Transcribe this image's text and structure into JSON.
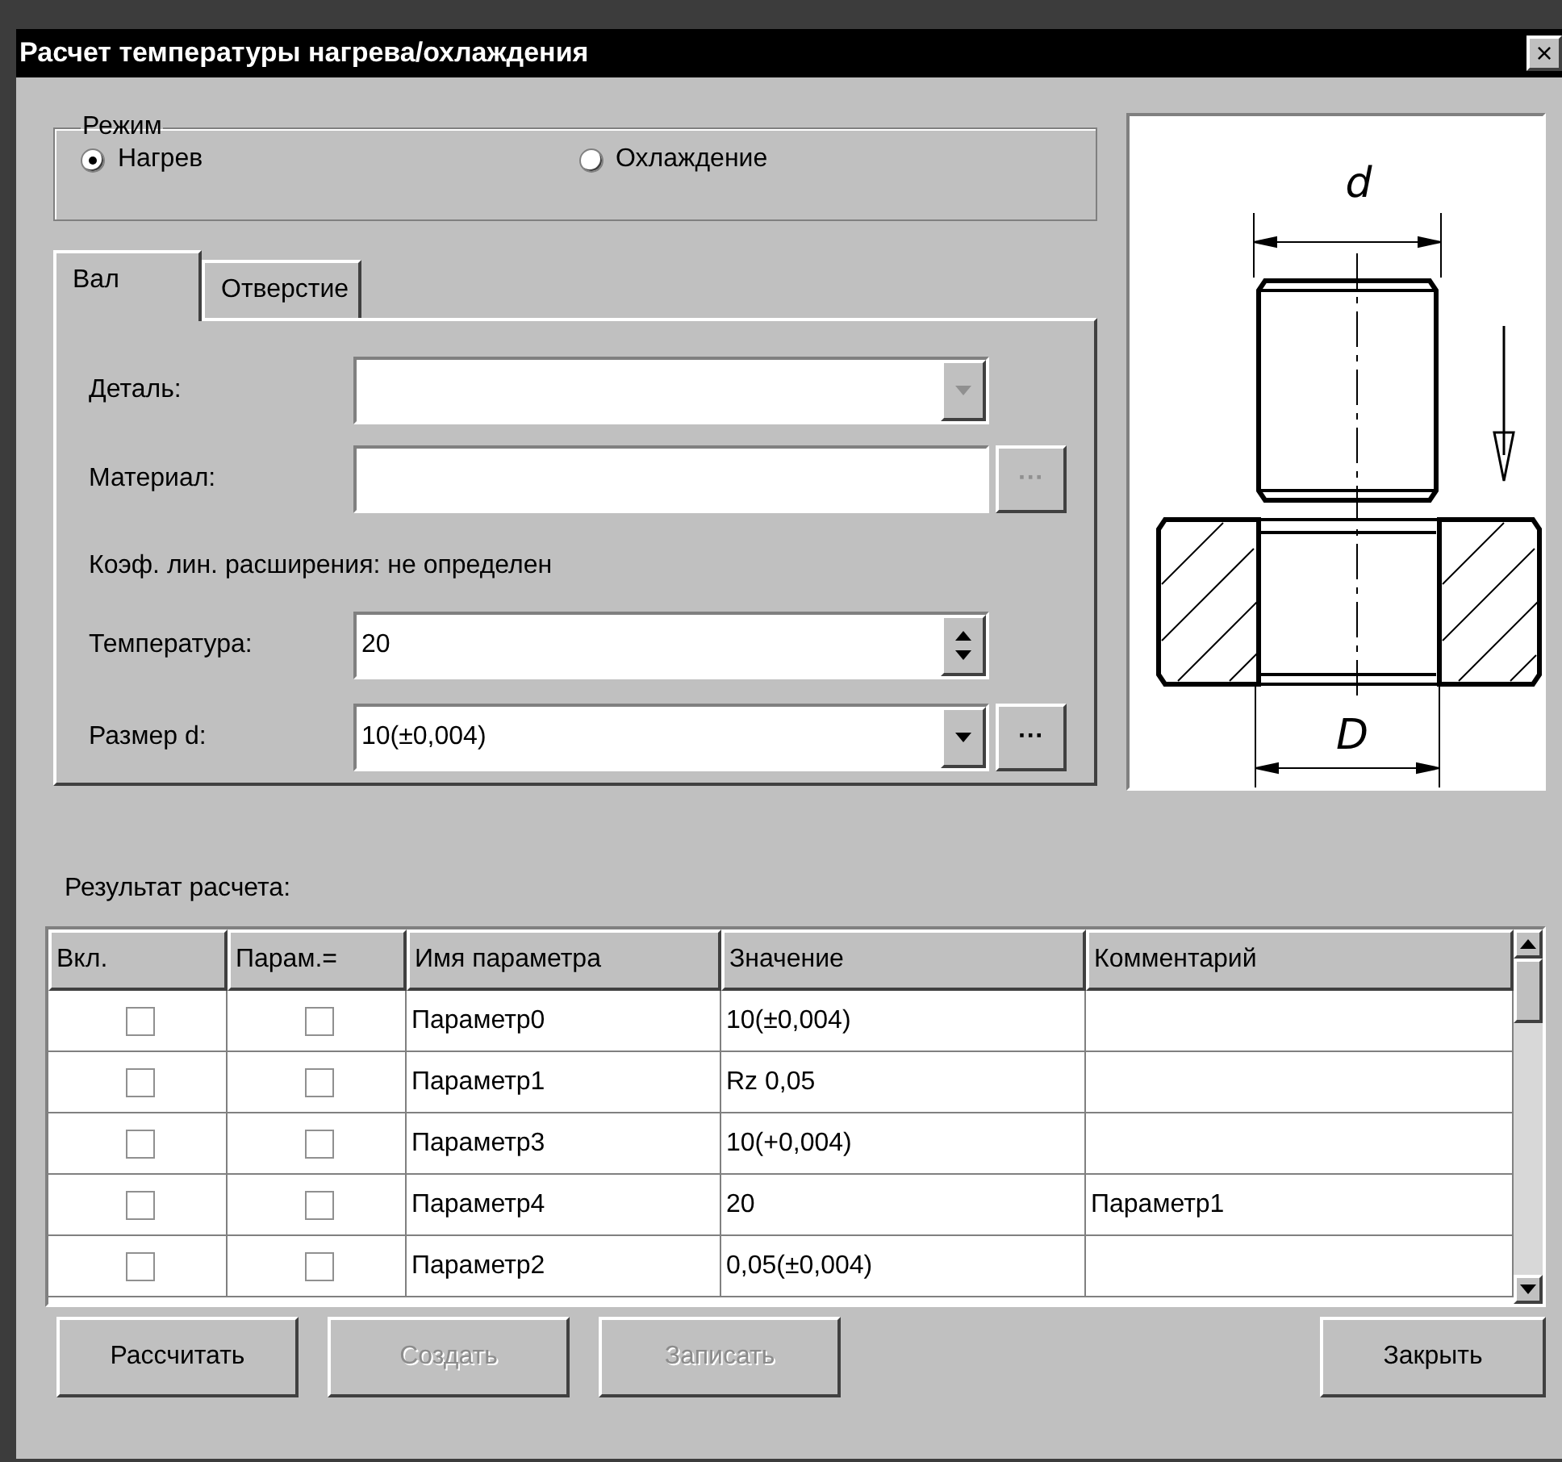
{
  "window": {
    "title": "Расчет температуры нагрева/охлаждения",
    "close": "×"
  },
  "mode": {
    "legend": "Режим",
    "options": [
      {
        "label": "Нагрев",
        "selected": true
      },
      {
        "label": "Охлаждение",
        "selected": false
      }
    ]
  },
  "tabs": [
    {
      "label": "Вал",
      "selected": true
    },
    {
      "label": "Отверстие",
      "selected": false
    }
  ],
  "form": {
    "detail_label": "Деталь:",
    "material_label": "Материал:",
    "material_button": "···",
    "coef_text": "Коэф. лин. расширения: не определен",
    "temperature_label": "Температура:",
    "temperature_value": "20",
    "size_label": "Размер d:",
    "size_value": "10(±0,004)",
    "size_button": "···"
  },
  "drawing": {
    "top_label": "d",
    "bottom_label": "D"
  },
  "result_label": "Результат расчета:",
  "table": {
    "columns": [
      "Вкл.",
      "Парам.=",
      "Имя параметра",
      "Значение",
      "Комментарий"
    ],
    "rows": [
      {
        "on": false,
        "param_eq": false,
        "name": "Параметр0",
        "value": "10(±0,004)",
        "comment": ""
      },
      {
        "on": false,
        "param_eq": false,
        "name": "Параметр1",
        "value": "Rz 0,05",
        "comment": ""
      },
      {
        "on": false,
        "param_eq": false,
        "name": "Параметр3",
        "value": "10(+0,004)",
        "comment": ""
      },
      {
        "on": false,
        "param_eq": false,
        "name": "Параметр4",
        "value": "20",
        "comment": "Параметр1"
      },
      {
        "on": false,
        "param_eq": false,
        "name": "Параметр2",
        "value": "0,05(±0,004)",
        "comment": ""
      }
    ]
  },
  "buttons": [
    {
      "label": "Рассчитать",
      "disabled": false
    },
    {
      "label": "Создать",
      "disabled": true
    },
    {
      "label": "Записать",
      "disabled": true
    },
    {
      "label": "Закрыть",
      "disabled": false
    }
  ]
}
